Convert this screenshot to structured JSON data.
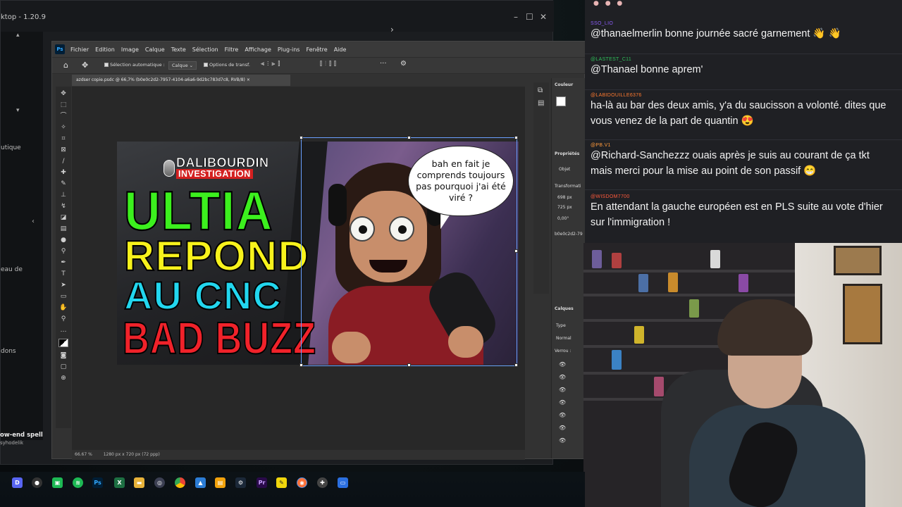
{
  "background_app": {
    "title": "ktop - 1.20.9",
    "sidebar_texts": [
      "utique",
      "eau de",
      "dons"
    ],
    "window_buttons": [
      "–",
      "☐",
      "✕"
    ]
  },
  "photoshop": {
    "menu": [
      "Fichier",
      "Edition",
      "Image",
      "Calque",
      "Texte",
      "Sélection",
      "Filtre",
      "Affichage",
      "Plug-ins",
      "Fenêtre",
      "Aide"
    ],
    "options": {
      "auto_select": "Sélection automatique :",
      "layer_select": "Calque",
      "transform": "Options de transf."
    },
    "document_tab": "azdser copie.psdc @ 66,7% (b0e0c2d2-7957-4104-a6a6-9d2bc783d7c8, RVB/8)",
    "status": {
      "zoom": "66.67 %",
      "size": "1280 px x 720 px (72 ppp)"
    },
    "right_panel": {
      "color": "Couleur",
      "properties": "Propriétés",
      "object": "Objet",
      "transform": "Transformati",
      "l_val": "698 px",
      "h_val": "725 px",
      "angle": "0,00°",
      "id": "b0e0c2d2-79",
      "layers": "Calques",
      "type": "Type",
      "mode": "Normal",
      "lock": "Verrou :"
    }
  },
  "thumbnail": {
    "logo_top": "DALIBOURDIN",
    "logo_sub": "INVESTIGATION",
    "line1": "ULTIA",
    "line2": "REPOND",
    "line3": "AU CNC",
    "line4": "BAD BUZZ",
    "bubble": "bah en fait je comprends toujours pas pourquoi j'ai été viré ?"
  },
  "chat": {
    "messages": [
      {
        "user": "SSO_LIO",
        "color": "#8a5cf6",
        "text": "@thanaelmerlin bonne journée sacré garnement 👋 👋"
      },
      {
        "user": "@LASTEST_C11",
        "color": "#2ebd59",
        "text": "@Thanael bonne aprem'"
      },
      {
        "user": "@LABIDOUILLE6376",
        "color": "#ff7a2f",
        "text": "ha-là au bar des deux amis, y'a du saucisson a volonté. dites que vous venez de la part de quantin 😍"
      },
      {
        "user": "@PB.V1",
        "color": "#ff9a3c",
        "text": "@Richard-Sanchezzz ouais après je suis au courant de ça tkt mais merci pour la mise au point de son passif 😁"
      },
      {
        "user": "@WISDOM7700",
        "color": "#ff5a3c",
        "text": "En attendant la gauche européen est en PLS suite au vote d'hier sur l'immigration !"
      }
    ]
  },
  "taskbar": {
    "now_playing": "ow-end spell",
    "now_playing_sub": "syhodelik",
    "icons": [
      "discord-icon",
      "obs-icon",
      "green-app-icon",
      "spotify-icon",
      "photoshop-icon",
      "excel-icon",
      "folder-icon",
      "app-icon",
      "chrome-icon",
      "photos-icon",
      "files-icon",
      "steam-icon",
      "premiere-icon",
      "notes-icon",
      "firefox-icon",
      "settings-icon",
      "screen-icon"
    ]
  }
}
